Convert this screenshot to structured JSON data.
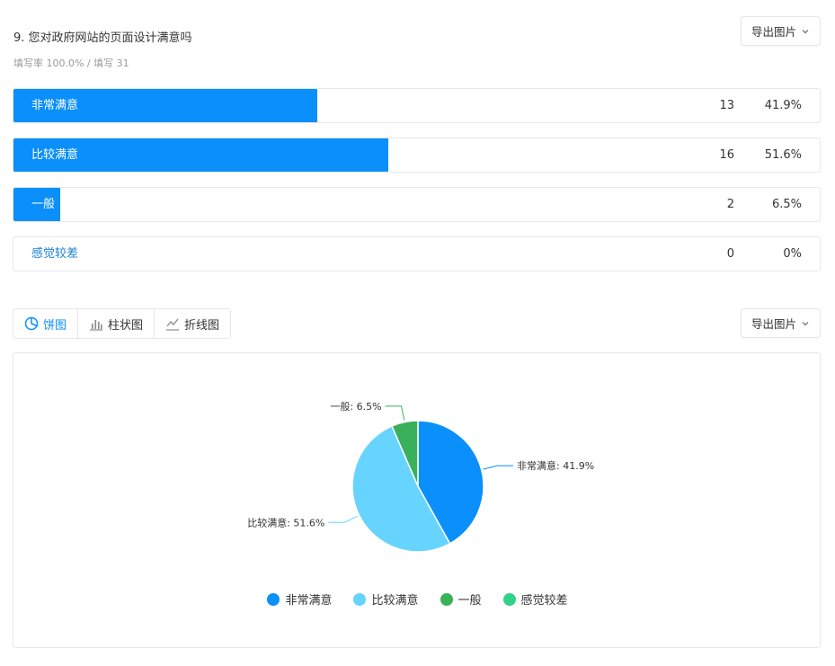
{
  "question": {
    "title": "9. 您对政府网站的页面设计满意吗",
    "subtitle": "填写率 100.0% / 填写 31",
    "export_label": "导出图片"
  },
  "results": [
    {
      "label": "非常满意",
      "count": "13",
      "percent": "41.9%",
      "fraction": 0.419
    },
    {
      "label": "比较满意",
      "count": "16",
      "percent": "51.6%",
      "fraction": 0.516
    },
    {
      "label": "一般",
      "count": "2",
      "percent": "6.5%",
      "fraction": 0.065
    },
    {
      "label": "感觉较差",
      "count": "0",
      "percent": "0%",
      "fraction": 0
    }
  ],
  "chart_tabs": [
    {
      "label": "饼图",
      "icon": "pie-chart-icon",
      "active": true
    },
    {
      "label": "柱状图",
      "icon": "bar-chart-icon",
      "active": false
    },
    {
      "label": "折线图",
      "icon": "line-chart-icon",
      "active": false
    }
  ],
  "chart_export_label": "导出图片",
  "colors": {
    "accent": "#0a8ffb",
    "series": [
      "#0a8ffb",
      "#66d4ff",
      "#3bb05a",
      "#33d189"
    ]
  },
  "chart_data": {
    "type": "pie",
    "categories": [
      "非常满意",
      "比较满意",
      "一般",
      "感觉较差"
    ],
    "values": [
      41.9,
      51.6,
      6.5,
      0
    ],
    "slice_labels": [
      "非常满意: 41.9%",
      "比较满意: 51.6%",
      "一般: 6.5%",
      ""
    ],
    "legend": [
      "非常满意",
      "比较满意",
      "一般",
      "感觉较差"
    ],
    "legend_position": "bottom"
  }
}
